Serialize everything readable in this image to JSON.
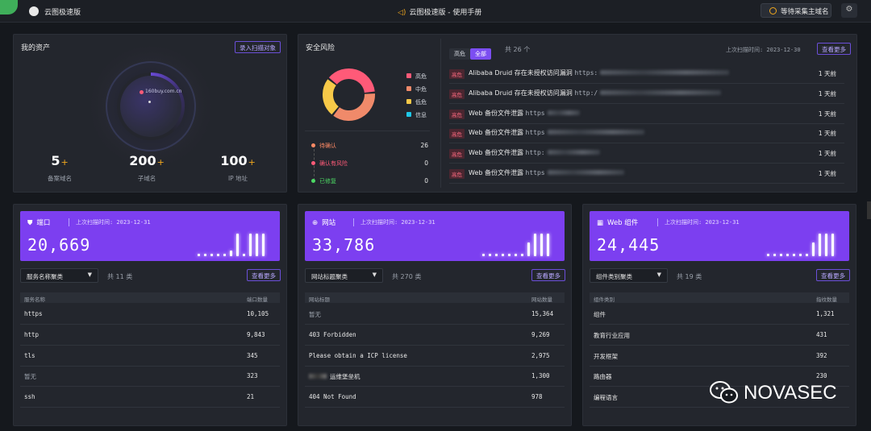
{
  "topbar": {
    "app_name": "云图极速版",
    "manual": "云图极速版 - 使用手册",
    "status_button": "等待采集主域名",
    "settings_icon": "gear-icon"
  },
  "assets": {
    "title": "我的资产",
    "import_button": "录入扫描对象",
    "domain_label": "160buy.com.cn",
    "stats": [
      {
        "value": "5",
        "plus": "+",
        "label": "备案域名"
      },
      {
        "value": "200",
        "plus": "+",
        "label": "子域名"
      },
      {
        "value": "100",
        "plus": "+",
        "label": "IP 地址"
      }
    ]
  },
  "risk": {
    "title": "安全风险",
    "legend": [
      {
        "label": "高危",
        "color": "#ff5a78"
      },
      {
        "label": "中危",
        "color": "#f08a6a"
      },
      {
        "label": "低危",
        "color": "#f7c948"
      },
      {
        "label": "信息",
        "color": "#1ec8e8"
      }
    ],
    "donut": [
      {
        "label": "高危",
        "value": 38,
        "color": "#ff5a78"
      },
      {
        "label": "中危",
        "value": 37,
        "color": "#f08a6a"
      },
      {
        "label": "低危",
        "value": 25,
        "color": "#f7c948"
      }
    ],
    "timeline": [
      {
        "label": "待确认",
        "value": "26",
        "color": "#ff8a65"
      },
      {
        "label": "确认有风险",
        "value": "0",
        "color": "#ff5a78"
      },
      {
        "label": "已修复",
        "value": "0",
        "color": "#4cd964"
      }
    ],
    "tabs": [
      "高危",
      "全部"
    ],
    "total": "共 26 个",
    "last_scan": "上次扫描时间: 2023-12-30",
    "more_button": "查看更多",
    "items": [
      {
        "badge": "高危",
        "title": "Alibaba Druid 存在未授权访问漏洞",
        "url_prefix": "https:",
        "ago": "1 天前"
      },
      {
        "badge": "高危",
        "title": "Alibaba Druid 存在未授权访问漏洞",
        "url_prefix": "http:/",
        "ago": "1 天前"
      },
      {
        "badge": "高危",
        "title": "Web 备份文件泄露",
        "url_prefix": "https",
        "ago": "1 天前"
      },
      {
        "badge": "高危",
        "title": "Web 备份文件泄露",
        "url_prefix": "https",
        "ago": "1 天前"
      },
      {
        "badge": "高危",
        "title": "Web 备份文件泄露",
        "url_prefix": "http:",
        "ago": "1 天前"
      },
      {
        "badge": "高危",
        "title": "Web 备份文件泄露",
        "url_prefix": "https",
        "ago": "1 天前"
      }
    ]
  },
  "cards": [
    {
      "icon": "shield-icon",
      "title": "端口",
      "last_scan": "上次扫描时间: 2023-12-31",
      "total": "20,669",
      "bars": [
        0.1,
        0.1,
        0.1,
        0.1,
        0.1,
        0.25,
        1.0,
        0.1,
        1.0,
        1.0,
        1.0
      ],
      "group_select": "服务名称聚类",
      "count": "共 11 类",
      "more_button": "查看更多",
      "col1": "服务名称",
      "col2": "端口数量",
      "rows": [
        {
          "name": "https",
          "value": "10,105"
        },
        {
          "name": "http",
          "value": "9,843"
        },
        {
          "name": "tls",
          "value": "345"
        },
        {
          "name": "暂无",
          "value": "323"
        },
        {
          "name": "ssh",
          "value": "21"
        }
      ]
    },
    {
      "icon": "globe-icon",
      "title": "网站",
      "last_scan": "上次扫描时间: 2023-12-31",
      "total": "33,786",
      "bars": [
        0.1,
        0.1,
        0.1,
        0.1,
        0.1,
        0.1,
        0.1,
        0.6,
        1.0,
        1.0,
        1.0
      ],
      "group_select": "网站标题聚类",
      "count": "共 270 类",
      "more_button": "查看更多",
      "col1": "网站标题",
      "col2": "网站数量",
      "rows": [
        {
          "name": "暂无",
          "value": "15,364"
        },
        {
          "name": "403 Forbidden",
          "value": "9,269"
        },
        {
          "name": "Please obtain a ICP license",
          "value": "2,975"
        },
        {
          "name": "运维堡垒机",
          "value": "1,300"
        },
        {
          "name": "404 Not Found",
          "value": "978"
        }
      ]
    },
    {
      "icon": "component-icon",
      "title": "Web 组件",
      "last_scan": "上次扫描时间: 2023-12-31",
      "total": "24,445",
      "bars": [
        0.1,
        0.1,
        0.1,
        0.1,
        0.1,
        0.1,
        0.1,
        0.6,
        1.0,
        1.0,
        1.0
      ],
      "group_select": "组件类别聚类",
      "count": "共 19 类",
      "more_button": "查看更多",
      "col1": "组件类别",
      "col2": "指纹数量",
      "rows": [
        {
          "name": "组件",
          "value": "1,321"
        },
        {
          "name": "教育行业应用",
          "value": "431"
        },
        {
          "name": "开发框架",
          "value": "392"
        },
        {
          "name": "路由器",
          "value": "230"
        },
        {
          "name": "编程语言",
          "value": ""
        }
      ]
    }
  ],
  "watermark": "NOVASEC"
}
